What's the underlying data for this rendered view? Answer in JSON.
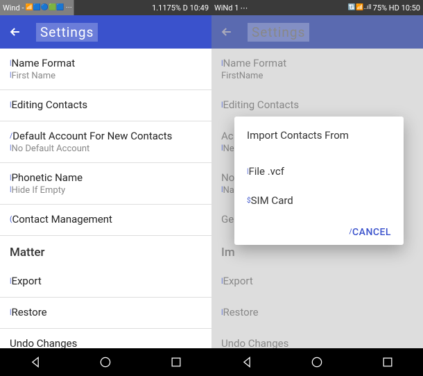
{
  "left": {
    "status": {
      "carrier": "Wind -",
      "extra": "1.1175% D 10:49"
    },
    "appbar": {
      "title": "Settings"
    },
    "items": [
      {
        "title": "Name Format",
        "sub": "First Name"
      },
      {
        "title": "Editing Contacts",
        "sub": ""
      },
      {
        "title": "Default Account For New Contacts",
        "sub": "No Default Account"
      },
      {
        "title": "Phonetic Name",
        "sub": "Hide If Empty"
      },
      {
        "title": "Contact Management",
        "sub": ""
      }
    ],
    "section": "Matter",
    "items2": [
      {
        "title": "Export"
      },
      {
        "title": "Restore"
      },
      {
        "title": "Undo Changes"
      }
    ]
  },
  "right": {
    "status": {
      "carrier": "WiNd 1",
      "extra": "75% HD 10:50"
    },
    "appbar": {
      "title": "Settings"
    },
    "items": [
      {
        "title": "Name Format",
        "sub": "FirstName"
      },
      {
        "title": "Editing Contacts",
        "sub": ""
      },
      {
        "title": "Ac",
        "sub": "Ne"
      },
      {
        "title": "Nooe",
        "sub": "Na"
      },
      {
        "title": "Ge",
        "sub": ""
      }
    ],
    "section": "Im",
    "items2": [
      {
        "title": "Export"
      },
      {
        "title": "Restore"
      },
      {
        "title": "Undo Changes"
      }
    ],
    "dialog": {
      "title": "Import Contacts From",
      "option1": "File .vcf",
      "option2": "SIM Card",
      "cancel": "CANCEL"
    }
  }
}
